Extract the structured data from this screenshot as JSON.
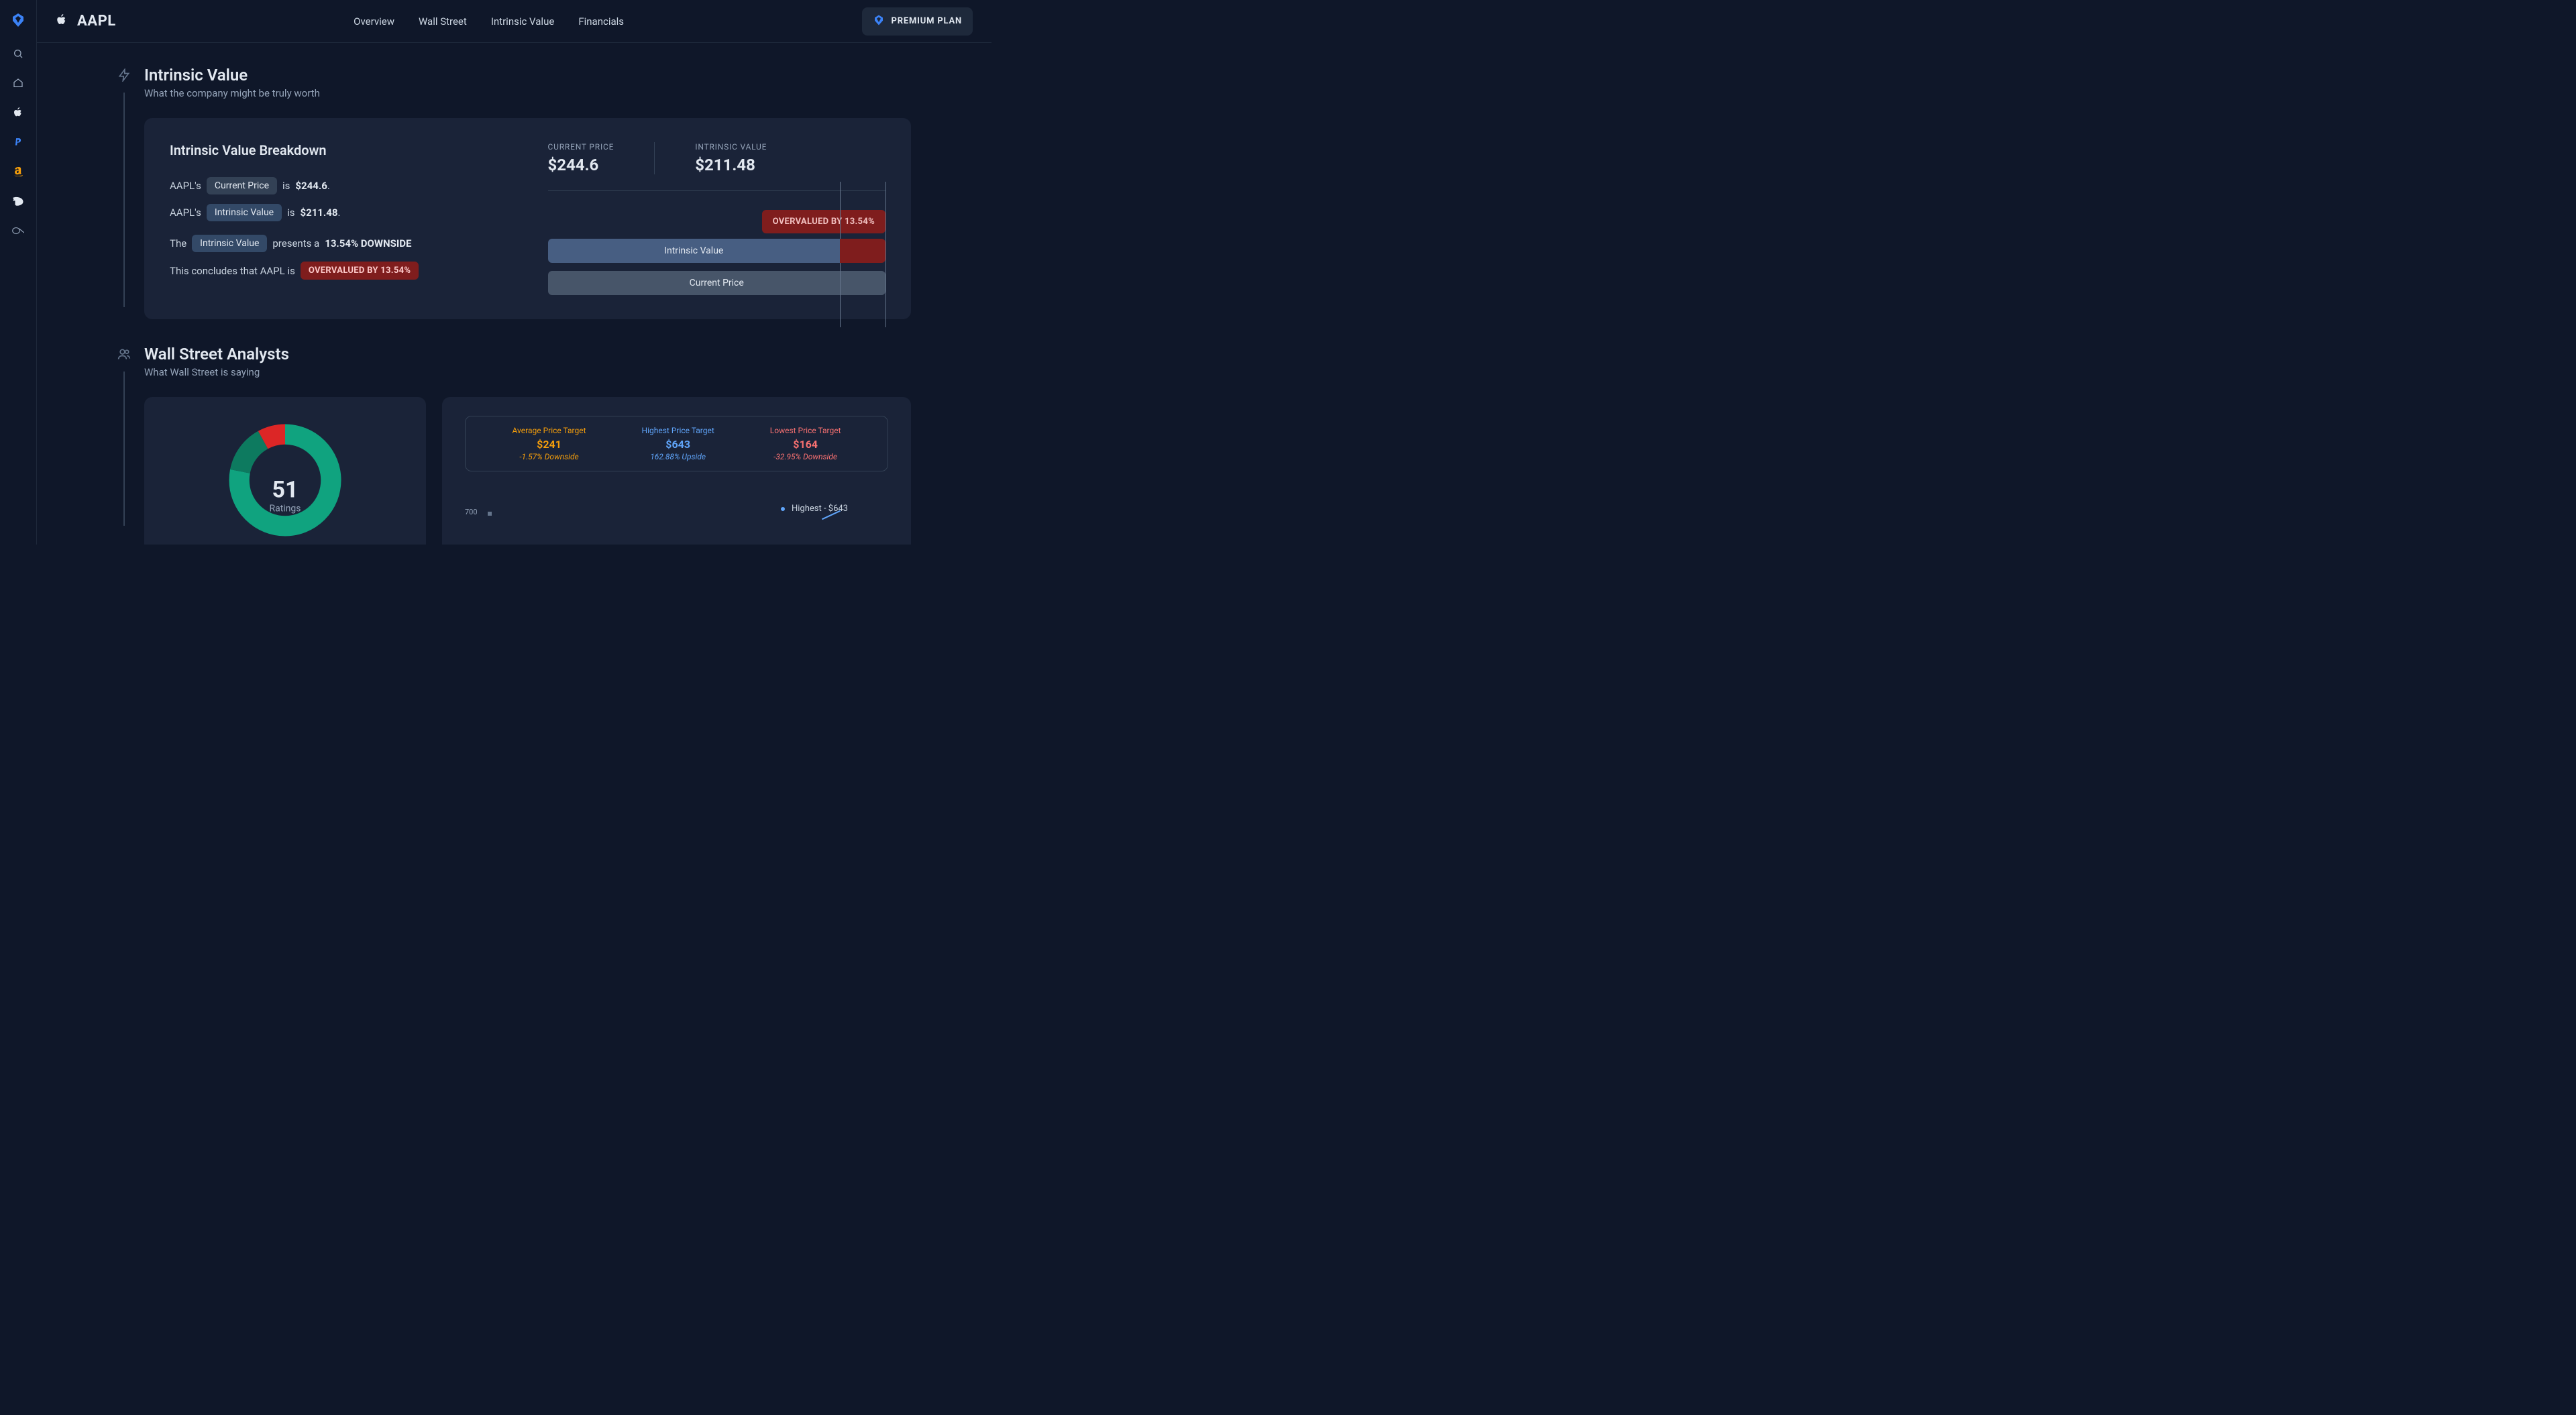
{
  "ticker": "AAPL",
  "nav": {
    "overview": "Overview",
    "wallstreet": "Wall Street",
    "intrinsic": "Intrinsic Value",
    "financials": "Financials"
  },
  "premium_label": "PREMIUM PLAN",
  "sections": {
    "intrinsic": {
      "title": "Intrinsic Value",
      "subtitle": "What the company might be truly worth"
    },
    "wallstreet": {
      "title": "Wall Street Analysts",
      "subtitle": "What Wall Street is saying"
    }
  },
  "iv": {
    "breakdown_title": "Intrinsic Value Breakdown",
    "line1_pre": "AAPL's",
    "pill_cp": "Current Price",
    "line1_mid": "is",
    "line1_val": "$244.6",
    "line1_post": ".",
    "line2_pre": "AAPL's",
    "pill_iv": "Intrinsic Value",
    "line2_mid": "is",
    "line2_val": "$211.48",
    "line2_post": ".",
    "line3_pre": "The",
    "line3_pill": "Intrinsic Value",
    "line3_mid": "presents a",
    "line3_val": "13.54% DOWNSIDE",
    "line4_pre": "This concludes that AAPL is",
    "line4_badge": "OVERVALUED BY 13.54%",
    "metric_cp_label": "CURRENT PRICE",
    "metric_cp_value": "$244.6",
    "metric_iv_label": "INTRINSIC VALUE",
    "metric_iv_value": "$211.48",
    "overval_badge": "OVERVALUED BY 13.54%",
    "bar_iv_label": "Intrinsic Value",
    "bar_cp_label": "Current Price"
  },
  "ws": {
    "ratings_count": "51",
    "ratings_label": "Ratings",
    "avg_label": "Average Price Target",
    "avg_value": "$241",
    "avg_change": "-1.57% Downside",
    "high_label": "Highest Price Target",
    "high_value": "$643",
    "high_change": "162.88% Upside",
    "low_label": "Lowest Price Target",
    "low_value": "$164",
    "low_change": "-32.95% Downside",
    "y_tick": "700",
    "highest_marker": "Highest - $643"
  },
  "chart_data": {
    "type": "bar",
    "intrinsic_value": 211.48,
    "current_price": 244.6,
    "overvalued_pct": 13.54,
    "analyst_targets": {
      "average": 241,
      "highest": 643,
      "lowest": 164
    },
    "ratings_count": 51,
    "donut_breakdown_approx": {
      "buy_pct": 78,
      "hold_pct": 14,
      "sell_pct": 8
    }
  }
}
